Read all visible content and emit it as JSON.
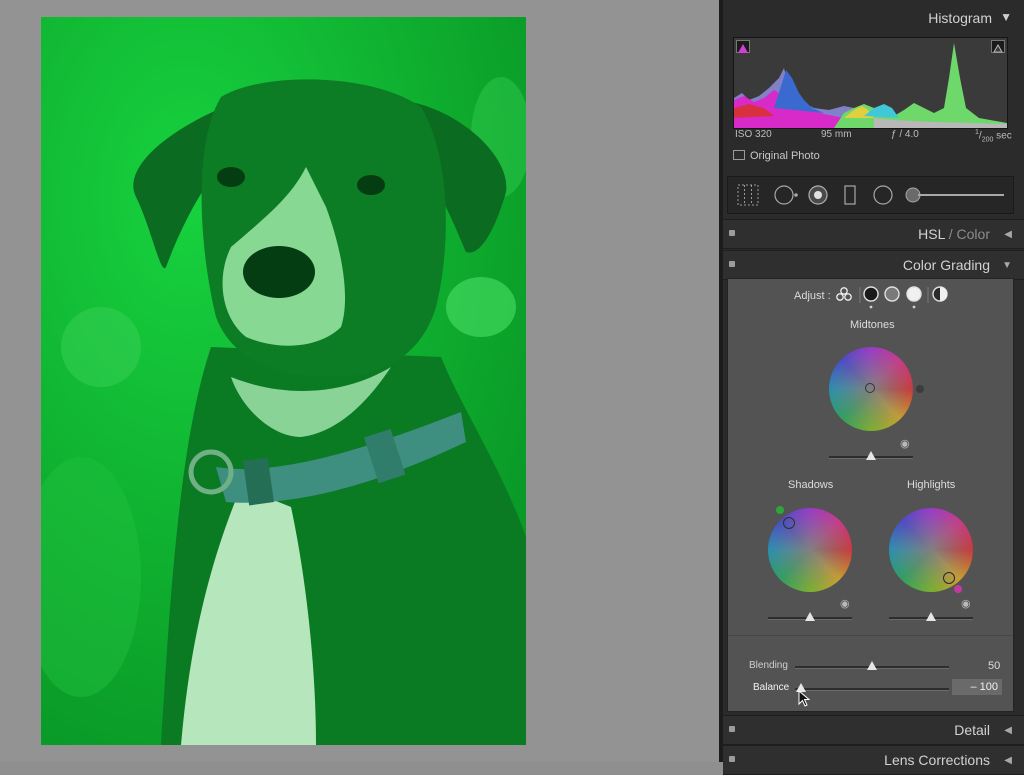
{
  "histogram": {
    "title": "Histogram",
    "iso": "ISO 320",
    "focal": "95 mm",
    "aperture": "ƒ / 4.0",
    "shutter_num": "1",
    "shutter_den": "200",
    "shutter_unit": "sec",
    "original_photo_label": "Original Photo"
  },
  "sections": {
    "hsl_part1": "HSL",
    "hsl_sep": " / ",
    "hsl_part2": "Color",
    "color_grading": "Color Grading",
    "detail": "Detail",
    "lens_corrections": "Lens Corrections"
  },
  "color_grading": {
    "adjust_label": "Adjust :",
    "midtones_label": "Midtones",
    "shadows_label": "Shadows",
    "highlights_label": "Highlights",
    "blending_label": "Blending",
    "blending_value": "50",
    "balance_label": "Balance",
    "balance_value": "– 100"
  },
  "colors": {
    "photo_tint": "#0db330",
    "panel_bg": "#2b2b2b",
    "grading_bg": "#535353"
  },
  "icons": [
    "triangle-down-icon",
    "clipping-warning-icon",
    "grid-overlay-icon",
    "crop-icon",
    "spot-removal-icon",
    "redeye-icon",
    "graduated-filter-icon",
    "radial-filter-icon",
    "brush-slider-icon",
    "three-wheels-icon",
    "eye-icon",
    "mouse-cursor-icon"
  ]
}
